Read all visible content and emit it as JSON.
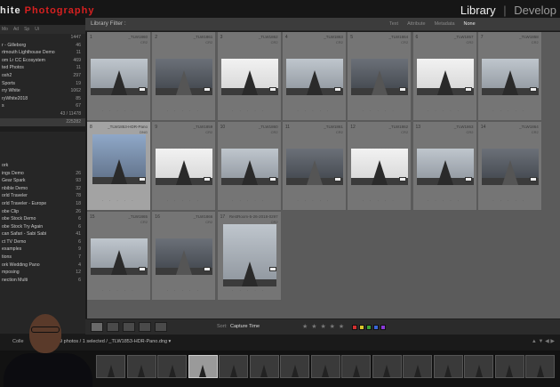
{
  "brand": {
    "word1": "hite",
    "word2": "Photography"
  },
  "modules": {
    "items": [
      "Library",
      "Develop"
    ],
    "active": "Library",
    "separator": "|"
  },
  "left_panel": {
    "head_tabs": [
      "Mo",
      "Ad",
      "Sp",
      "Ui"
    ],
    "catalog_rows": [
      {
        "label": "",
        "count": "1447"
      },
      {
        "label": "r - Gilleborg",
        "count": "46"
      },
      {
        "label": "rtmouth Lighthouse Demo",
        "count": "11"
      },
      {
        "label": "om Lr CC Ecosystem",
        "count": "469"
      },
      {
        "label": "ted Photos",
        "count": "11"
      },
      {
        "label": "osh2",
        "count": "297"
      },
      {
        "label": "Sports",
        "count": "19"
      },
      {
        "label": "rry White",
        "count": "1062"
      },
      {
        "label": "ryWhite2018",
        "count": "85"
      },
      {
        "label": "s",
        "count": "67"
      }
    ],
    "totals": [
      "43 / 11478",
      "225282"
    ],
    "collection_rows": [
      {
        "label": "ork",
        "count": ""
      },
      {
        "label": "ings Demo",
        "count": "26"
      },
      {
        "label": "Gear Spark",
        "count": "93"
      },
      {
        "label": "nbible Demo",
        "count": "32"
      },
      {
        "label": "orld Traveler",
        "count": "78"
      },
      {
        "label": "orld Traveler - Europe",
        "count": "18"
      },
      {
        "label": "obe Clip",
        "count": "26"
      },
      {
        "label": "obe Stock Demo",
        "count": "6"
      },
      {
        "label": "obe Stock Try Again",
        "count": "6"
      },
      {
        "label": "can Safari - Sabi Sabi",
        "count": "41"
      },
      {
        "label": "ct TV Demo",
        "count": "6"
      },
      {
        "label": "examples",
        "count": "9"
      },
      {
        "label": "tions",
        "count": "7"
      },
      {
        "label": "ork Wedding Pano",
        "count": "4"
      },
      {
        "label": "mposing",
        "count": "12"
      },
      {
        "label": "nection Multi",
        "count": "6"
      }
    ]
  },
  "filter_bar": {
    "title": "Library Filter :",
    "options": [
      "Text",
      "Attribute",
      "Metadata",
      "None"
    ],
    "active": "None"
  },
  "grid": {
    "cells": [
      {
        "idx": "1",
        "file": "_TLW1860",
        "ext": "CR2",
        "tone": "",
        "shape": "",
        "selected": false
      },
      {
        "idx": "2",
        "file": "_TLW1861",
        "ext": "CR2",
        "tone": "dark",
        "shape": "",
        "selected": false
      },
      {
        "idx": "3",
        "file": "_TLW1862",
        "ext": "CR2",
        "tone": "bright",
        "shape": "",
        "selected": false
      },
      {
        "idx": "4",
        "file": "_TLW1863",
        "ext": "CR2",
        "tone": "",
        "shape": "",
        "selected": false
      },
      {
        "idx": "5",
        "file": "_TLW1864",
        "ext": "CR2",
        "tone": "dark",
        "shape": "",
        "selected": false
      },
      {
        "idx": "6",
        "file": "_TLW1857",
        "ext": "CR2",
        "tone": "bright",
        "shape": "",
        "selected": false
      },
      {
        "idx": "7",
        "file": "_TLW1858",
        "ext": "CR2",
        "tone": "",
        "shape": "",
        "selected": false
      },
      {
        "idx": "8",
        "file": "_TLW1853-HDR-Pano",
        "ext": "DNG",
        "tone": "blue",
        "shape": "pano",
        "selected": true
      },
      {
        "idx": "9",
        "file": "_TLW1859",
        "ext": "CR2",
        "tone": "bright",
        "shape": "",
        "selected": false
      },
      {
        "idx": "10",
        "file": "_TLW1860",
        "ext": "CR2",
        "tone": "",
        "shape": "",
        "selected": false
      },
      {
        "idx": "11",
        "file": "_TLW1861",
        "ext": "CR2",
        "tone": "dark",
        "shape": "",
        "selected": false
      },
      {
        "idx": "12",
        "file": "_TLW1862",
        "ext": "CR2",
        "tone": "bright",
        "shape": "",
        "selected": false
      },
      {
        "idx": "13",
        "file": "_TLW1863",
        "ext": "CR2",
        "tone": "",
        "shape": "",
        "selected": false
      },
      {
        "idx": "14",
        "file": "_TLW1864",
        "ext": "CR2",
        "tone": "dark",
        "shape": "",
        "selected": false
      },
      {
        "idx": "15",
        "file": "_TLW1865",
        "ext": "CR2",
        "tone": "",
        "shape": "",
        "selected": false
      },
      {
        "idx": "16",
        "file": "_TLW1866",
        "ext": "CR2",
        "tone": "dark",
        "shape": "",
        "selected": false
      },
      {
        "idx": "17",
        "file": "RestRoom-5-26-2018-0297",
        "ext": "CR2",
        "tone": "",
        "shape": "tall",
        "selected": false
      }
    ]
  },
  "toolbar": {
    "sort_label": "Sort:",
    "sort_value": "Capture Time",
    "stars": "★ ★ ★ ★ ★",
    "swatches": [
      "#d43030",
      "#d8c52a",
      "#3aa33a",
      "#3a66d8",
      "#8a3ad8"
    ]
  },
  "filmstrip_header": {
    "collection": "Colle",
    "info": "19 photos / 1 selected / _TLW1853-HDR-Pano.dng ▾",
    "icons": "▲ ▼ ◀ ▶"
  },
  "filmstrip": {
    "count": 15,
    "selected_index": 3
  }
}
